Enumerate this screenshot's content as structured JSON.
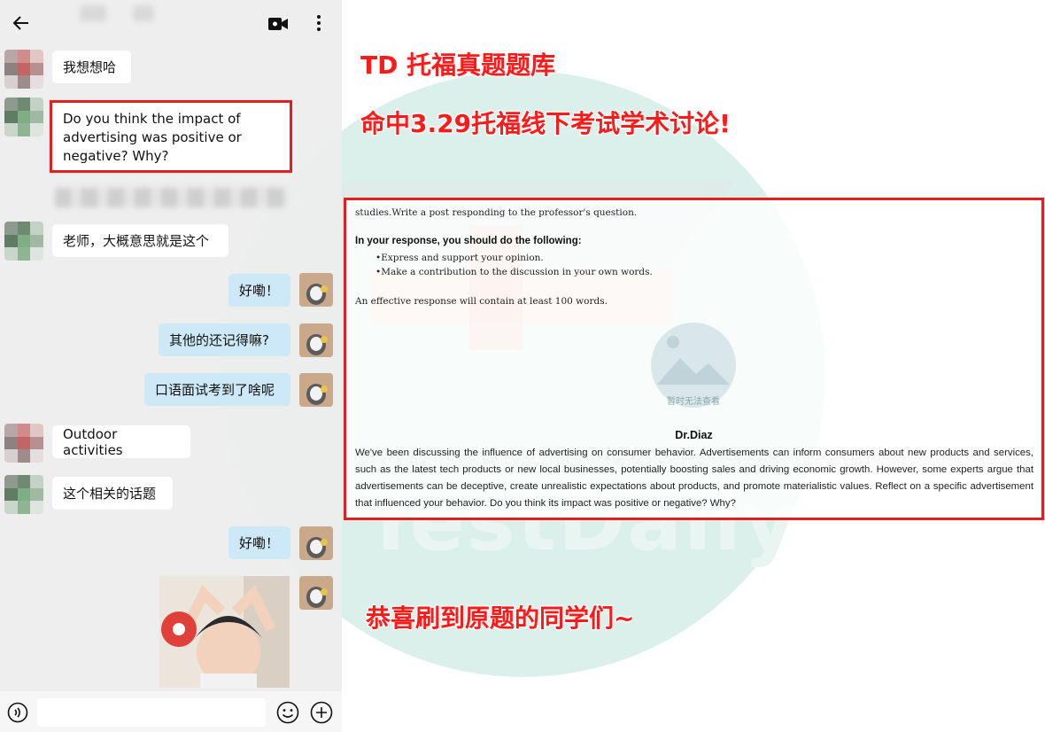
{
  "watermark": {
    "text": "TestDaily"
  },
  "chat": {
    "messages": [
      {
        "text": "我想想哈"
      },
      {
        "text": "Do you think the impact of advertising was positive or negative? Why?"
      },
      {
        "text": "老师，大概意思就是这个"
      },
      {
        "text": "好嘞！"
      },
      {
        "text": "其他的还记得嘛?"
      },
      {
        "text": "口语面试考到了啥呢"
      },
      {
        "text": "Outdoor activities"
      },
      {
        "text": "这个相关的话题"
      },
      {
        "text": "好嘞！"
      }
    ]
  },
  "headings": {
    "line1": "TD 托福真题题库",
    "line2": "命中3.29托福线下考试学术讨论!",
    "line3": "恭喜刷到原题的同学们~"
  },
  "question": {
    "intro": "studies.Write a post responding to the professor's question.",
    "response_heading": "In your response, you should do the following:",
    "bullets": [
      "•Express and support your opinion.",
      "•Make a contribution to the discussion in your own words."
    ],
    "effective": "An effective response will contain at least 100 words.",
    "image_placeholder": "暂时无法查看",
    "professor": "Dr.Diaz",
    "body": "We've been discussing the influence of advertising on consumer behavior. Advertisements can inform consumers about new products and services, such as the latest tech products or new local businesses, potentially boosting sales and driving economic growth. However, some experts argue that advertisements can be deceptive, create unrealistic expectations about products, and promote materialistic values. Reflect on a specific advertisement that influenced your behavior. Do you think its impact was positive or negative? Why?"
  },
  "colors": {
    "accent": "#e02020",
    "heading": "#ff1a1a",
    "my_bubble": "#cde9f8",
    "watermark": "#bfe3da"
  }
}
